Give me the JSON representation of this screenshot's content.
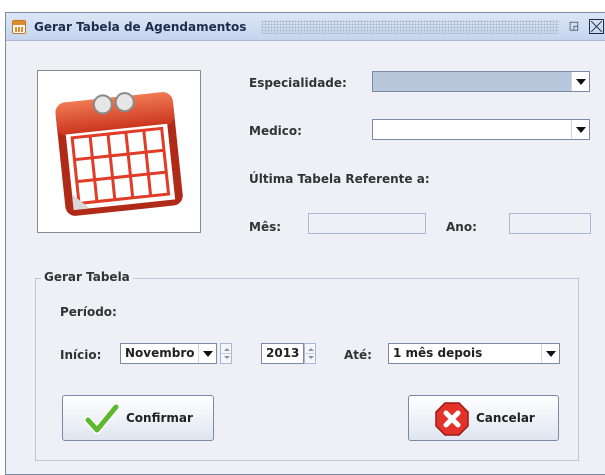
{
  "window": {
    "title": "Gerar Tabela de Agendamentos"
  },
  "form": {
    "especialidade_label": "Especialidade:",
    "especialidade_value": "",
    "medico_label": "Medico:",
    "medico_value": "",
    "ultima_tabela_label": "Última Tabela Referente a:",
    "mes_label": "Mês:",
    "mes_value": "",
    "ano_label": "Ano:",
    "ano_value": ""
  },
  "gerar_tabela": {
    "group_title": "Gerar Tabela",
    "periodo_label": "Período:",
    "inicio_label": "Início:",
    "mes_selected": "Novembro",
    "ano_value": "2013",
    "ate_label": "Até:",
    "ate_selected": "1 mês depois"
  },
  "buttons": {
    "confirm_label": "Confirmar",
    "cancel_label": "Cancelar"
  },
  "icons": {
    "app": "calendar-icon",
    "main_image": "calendar-icon",
    "confirm": "check-icon",
    "cancel": "cancel-x-icon"
  }
}
